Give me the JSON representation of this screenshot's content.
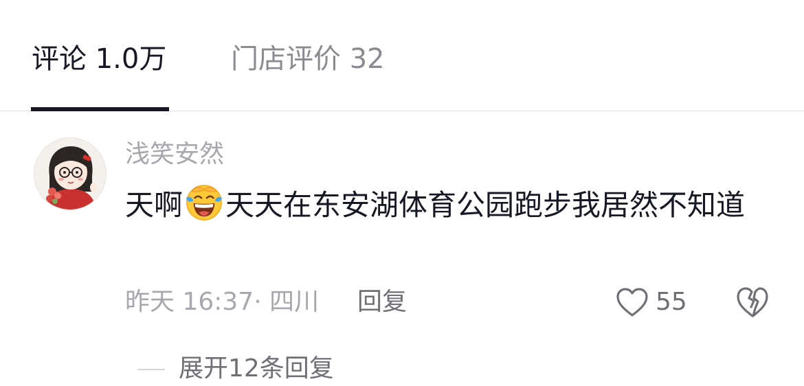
{
  "tabs": [
    {
      "label": "评论 1.0万",
      "active": true
    },
    {
      "label": "门店评价 32",
      "active": false
    }
  ],
  "comment": {
    "username": "浅笑安然",
    "text_before_emoji": "天啊",
    "emoji": "laughing-crying-emoji",
    "text_after_emoji": "天天在东安湖体育公园跑步我居然不知道",
    "meta": "昨天 16:37· 四川",
    "reply_label": "回复",
    "like_count": "55",
    "more_replies": "展开12条回复"
  },
  "colors": {
    "primary_text": "#161823",
    "secondary_text": "#a7a8ad",
    "action_text": "#6f7076",
    "divider": "#e3e3e6"
  }
}
